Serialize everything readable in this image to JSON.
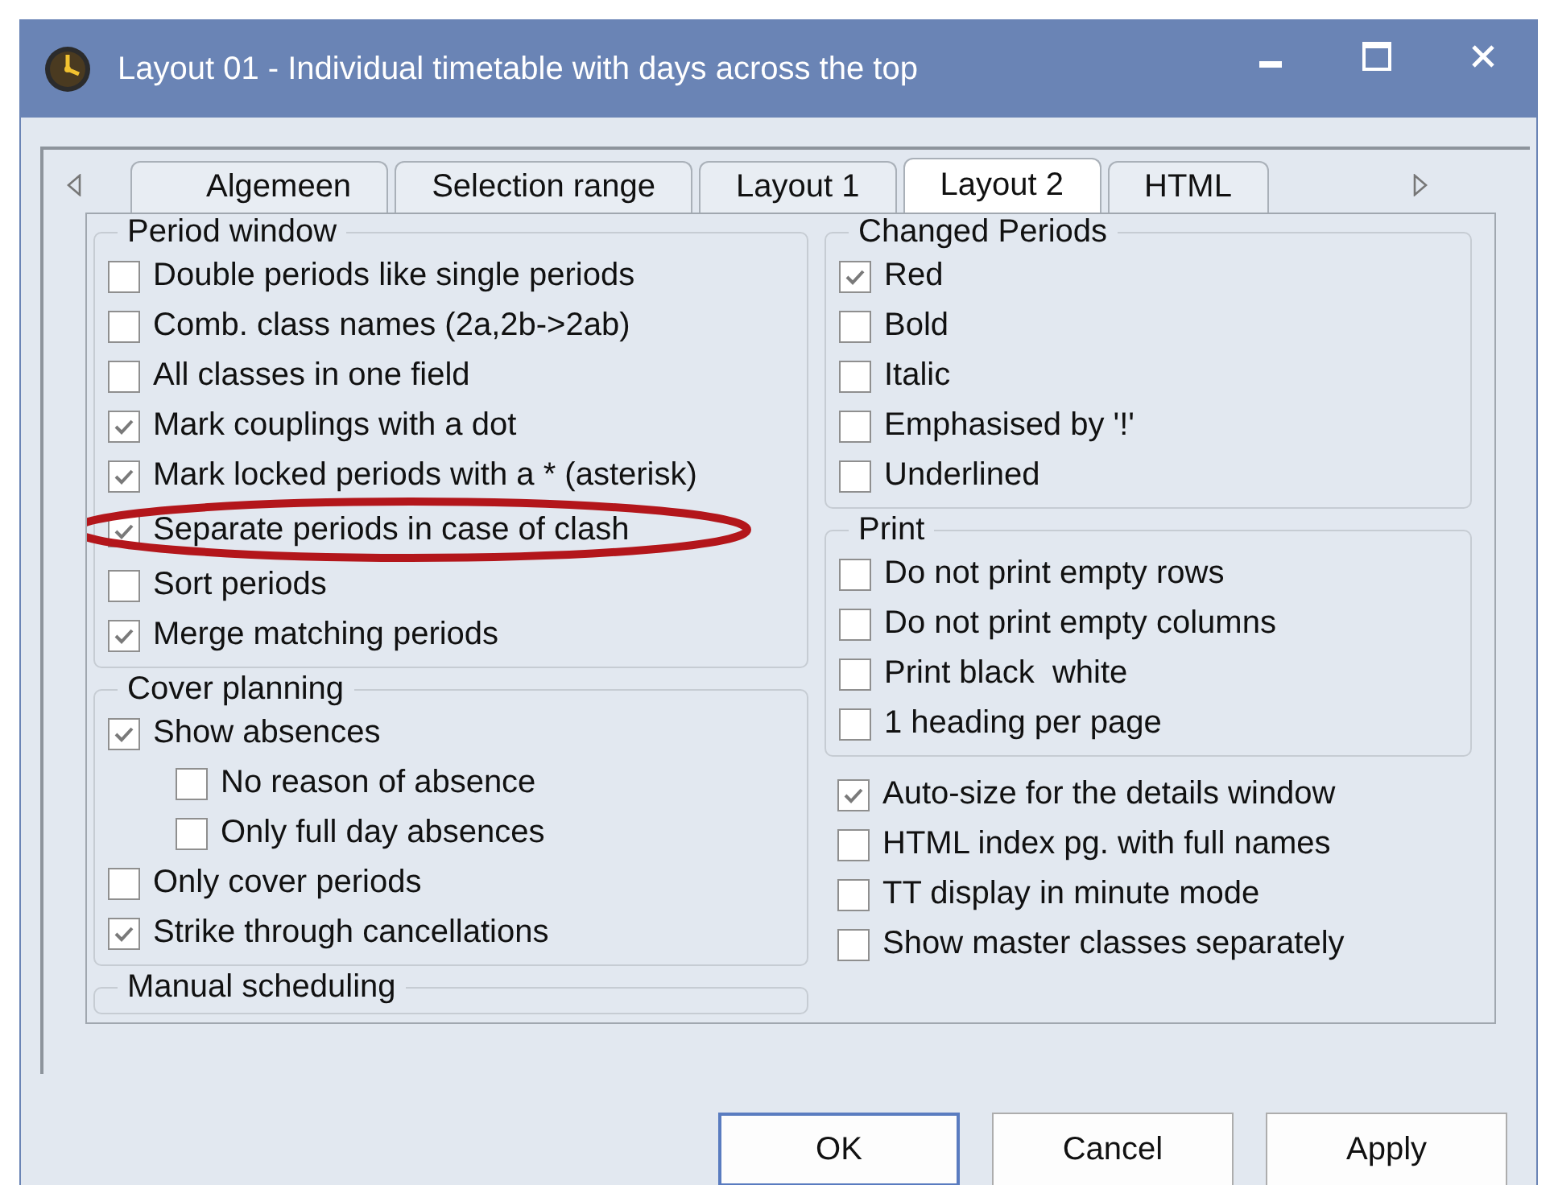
{
  "window": {
    "title": "Layout 01 - Individual timetable with days across the top"
  },
  "tabs": [
    {
      "label": "Algemeen",
      "selected": false
    },
    {
      "label": "Selection range",
      "selected": false
    },
    {
      "label": "Layout 1",
      "selected": false
    },
    {
      "label": "Layout 2",
      "selected": true
    },
    {
      "label": "HTML",
      "selected": false
    }
  ],
  "left_column": [
    {
      "kind": "group",
      "title": "Period window",
      "items": [
        {
          "label": "Double periods like single periods",
          "checked": false
        },
        {
          "label": "Comb. class names (2a,2b->2ab)",
          "checked": false
        },
        {
          "label": "All classes in one field",
          "checked": false
        },
        {
          "label": "Mark couplings with a dot",
          "checked": true
        },
        {
          "label": "Mark locked periods with a * (asterisk)",
          "checked": true
        },
        {
          "label": "Separate periods in case of clash",
          "checked": true,
          "highlighted": true
        },
        {
          "label": "Sort periods",
          "checked": false
        },
        {
          "label": "Merge matching periods",
          "checked": true
        }
      ]
    },
    {
      "kind": "group",
      "title": "Cover planning",
      "items": [
        {
          "label": "Show absences",
          "checked": true,
          "children": [
            {
              "label": "No reason of absence",
              "checked": false
            },
            {
              "label": "Only full day absences",
              "checked": false
            }
          ]
        },
        {
          "label": "Only cover periods",
          "checked": false
        },
        {
          "label": "Strike through cancellations",
          "checked": true
        }
      ]
    },
    {
      "kind": "group",
      "title": "Manual scheduling"
    }
  ],
  "right_column": [
    {
      "kind": "group",
      "title": "Changed Periods",
      "items": [
        {
          "label": "Red",
          "checked": true
        },
        {
          "label": "Bold",
          "checked": false
        },
        {
          "label": "Italic",
          "checked": false
        },
        {
          "label": "Emphasised by '!'",
          "checked": false
        },
        {
          "label": "Underlined",
          "checked": false
        }
      ]
    },
    {
      "kind": "group",
      "title": "Print",
      "items": [
        {
          "label": "Do not print empty rows",
          "checked": false
        },
        {
          "label": "Do not print empty columns",
          "checked": false
        },
        {
          "label": "Print black  white",
          "checked": false
        },
        {
          "label": "1 heading per page",
          "checked": false
        }
      ]
    },
    {
      "kind": "list",
      "items": [
        {
          "label": "Auto-size for the details window",
          "checked": true
        },
        {
          "label": "HTML index pg. with full names",
          "checked": false
        },
        {
          "label": "TT display in minute mode",
          "checked": false
        },
        {
          "label": "Show master classes separately",
          "checked": false
        }
      ]
    }
  ],
  "buttons": [
    {
      "label": "OK",
      "default": true
    },
    {
      "label": "Cancel",
      "default": false
    },
    {
      "label": "Apply",
      "default": false
    }
  ]
}
